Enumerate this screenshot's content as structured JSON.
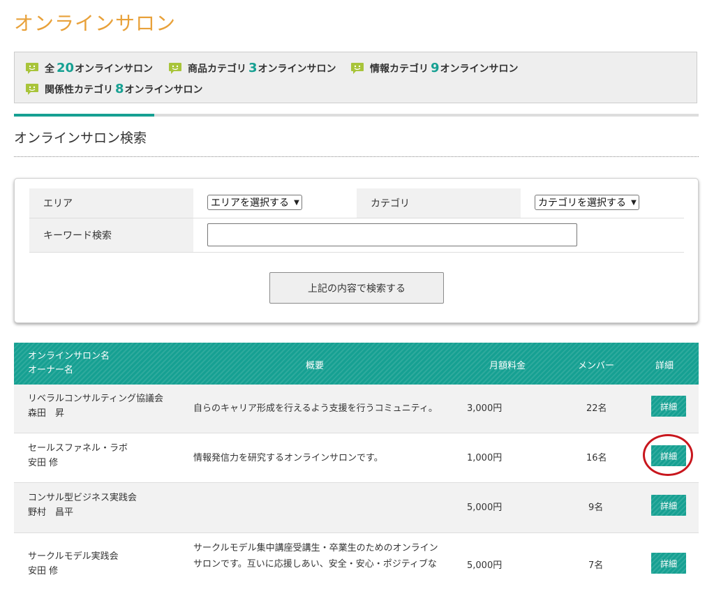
{
  "page": {
    "title": "オンラインサロン"
  },
  "stats": {
    "total": {
      "prefix": "全",
      "count": "20",
      "suffix": "オンラインサロン"
    },
    "product": {
      "prefix": "商品カテゴリ",
      "count": "3",
      "suffix": "オンラインサロン"
    },
    "info": {
      "prefix": "情報カテゴリ",
      "count": "9",
      "suffix": "オンラインサロン"
    },
    "relation": {
      "prefix": "関係性カテゴリ",
      "count": "8",
      "suffix": "オンラインサロン"
    }
  },
  "search": {
    "section_title": "オンラインサロン検索",
    "area_label": "エリア",
    "area_select": "エリアを選択する",
    "category_label": "カテゴリ",
    "category_select": "カテゴリを選択する",
    "keyword_label": "キーワード検索",
    "keyword_value": "",
    "submit_label": "上記の内容で検索する"
  },
  "table": {
    "headers": {
      "name_line1": "オンラインサロン名",
      "name_line2": "オーナー名",
      "overview": "概要",
      "fee": "月額料金",
      "members": "メンバー",
      "detail": "詳細"
    },
    "rows": [
      {
        "name": "リベラルコンサルティング協議会",
        "owner": "森田　昇",
        "overview_line1": "自らのキャリア形成を行えるよう支援を行うコミュニティ。",
        "overview_line2": "",
        "fee": "3,000円",
        "members": "22名",
        "detail": "詳細"
      },
      {
        "name": "セールスファネル・ラボ",
        "owner": "安田 修",
        "overview_line1": "情報発信力を研究するオンラインサロンです。",
        "overview_line2": "",
        "fee": "1,000円",
        "members": "16名",
        "detail": "詳細"
      },
      {
        "name": "コンサル型ビジネス実践会",
        "owner": "野村　昌平",
        "overview_line1": "",
        "overview_line2": "",
        "fee": "5,000円",
        "members": "9名",
        "detail": "詳細"
      },
      {
        "name": "サークルモデル実践会",
        "owner": "安田 修",
        "overview_line1": "サークルモデル集中講座受講生・卒業生のためのオンライン",
        "overview_line2": "サロンです。互いに応援しあい、安全・安心・ポジティブな",
        "fee": "5,000円",
        "members": "7名",
        "detail": "詳細"
      }
    ]
  },
  "colors": {
    "title": "#e8a13a",
    "accent": "#16a092",
    "annotation": "#c8161d"
  },
  "icons": {
    "stat_icon": "chat-bubble-icon",
    "select_caret": "chevron-down-icon"
  }
}
